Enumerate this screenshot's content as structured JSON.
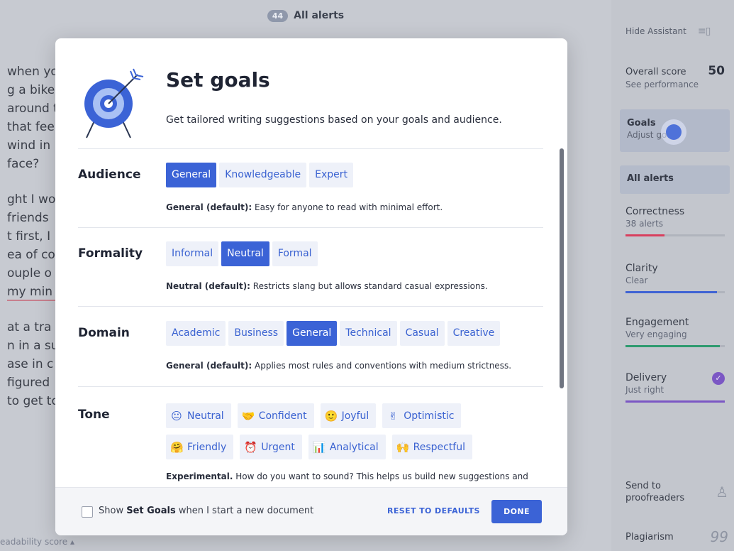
{
  "editor": {
    "alert_count": "44",
    "alert_title": "All alerts",
    "lines": [
      "when yo",
      "g a bike",
      "around t",
      "that fee",
      "wind in",
      "face?",
      "ght I wo",
      "friends",
      "t first, I",
      "ea of co",
      "ouple o",
      "my min",
      "at a tra",
      "n in a su",
      "ase in c",
      "figured",
      "to get to"
    ],
    "readability": "eadability score ▴"
  },
  "sidebar": {
    "hide_label": "Hide Assistant",
    "hide_icon": "≡▯",
    "overall_label": "Overall score",
    "overall_value": "50",
    "overall_sub": "See performance",
    "goals_label": "Goals",
    "goals_sub": "Adjust goals",
    "all_alerts": "All alerts",
    "metrics": [
      {
        "name": "Correctness",
        "sub": "38 alerts",
        "color": "#d8405e",
        "fill": 0.39
      },
      {
        "name": "Clarity",
        "sub": "Clear",
        "color": "#3f63d4",
        "fill": 0.92
      },
      {
        "name": "Engagement",
        "sub": "Very engaging",
        "color": "#2e9b6f",
        "fill": 0.95
      },
      {
        "name": "Delivery",
        "sub": "Just right",
        "color": "#7b57c4",
        "fill": 1.0
      }
    ],
    "delivery_check": "✓",
    "send_label": "Send to proofreaders",
    "send_icon": "♙",
    "plagiarism_label": "Plagiarism",
    "plagiarism_icon": "99"
  },
  "modal": {
    "title": "Set goals",
    "subtitle": "Get tailored writing suggestions based on your goals and audience.",
    "sections": [
      {
        "label": "Audience",
        "options": [
          "General",
          "Knowledgeable",
          "Expert"
        ],
        "active": 0,
        "desc_bold": "General (default):",
        "desc": " Easy for anyone to read with minimal effort."
      },
      {
        "label": "Formality",
        "options": [
          "Informal",
          "Neutral",
          "Formal"
        ],
        "active": 1,
        "desc_bold": "Neutral (default):",
        "desc": " Restricts slang but allows standard casual expressions."
      },
      {
        "label": "Domain",
        "options": [
          "Academic",
          "Business",
          "General",
          "Technical",
          "Casual",
          "Creative"
        ],
        "active": 2,
        "desc_bold": "General (default):",
        "desc": " Applies most rules and conventions with medium strictness."
      }
    ],
    "tone": {
      "label": "Tone",
      "options": [
        {
          "emoji": "😐",
          "label": "Neutral"
        },
        {
          "emoji": "🤝",
          "label": "Confident"
        },
        {
          "emoji": "🙂",
          "label": "Joyful"
        },
        {
          "emoji": "✌",
          "label": "Optimistic"
        },
        {
          "emoji": "🤗",
          "label": "Friendly"
        },
        {
          "emoji": "⏰",
          "label": "Urgent"
        },
        {
          "emoji": "📊",
          "label": "Analytical"
        },
        {
          "emoji": "🙌",
          "label": "Respectful"
        }
      ],
      "desc_bold": "Experimental.",
      "desc": " How do you want to sound? This helps us build new suggestions and"
    },
    "footer": {
      "checkbox_pre": "Show ",
      "checkbox_bold": "Set Goals",
      "checkbox_post": " when I start a new document",
      "reset": "RESET TO DEFAULTS",
      "done": "DONE"
    }
  },
  "colors": {
    "accent": "#3b63d6",
    "accent_light": "#eef1f9"
  }
}
